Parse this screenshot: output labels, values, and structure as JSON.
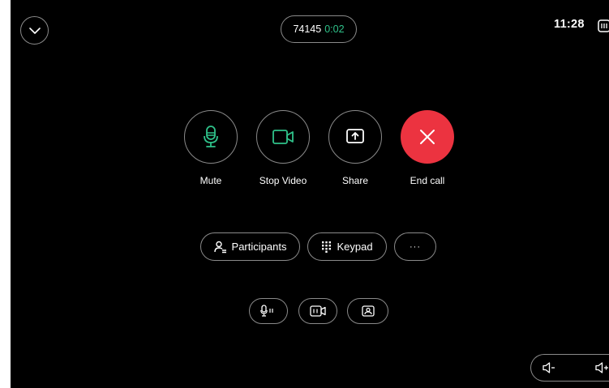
{
  "call": {
    "number": "74145",
    "duration": "0:02",
    "clock": "11:28"
  },
  "controls": {
    "mute_label": "Mute",
    "stop_video_label": "Stop Video",
    "share_label": "Share",
    "end_call_label": "End call"
  },
  "actions": {
    "participants_label": "Participants",
    "keypad_label": "Keypad",
    "more_label": "···"
  },
  "colors": {
    "accent_green": "#2fc28a",
    "end_call_red": "#ec3340",
    "outline": "#8a8a8a",
    "background": "#000000"
  },
  "icons": {
    "collapse": "chevron-down-icon",
    "layout": "layout-icon",
    "mute": "microphone-icon",
    "video": "video-camera-icon",
    "share": "share-icon",
    "end_call": "close-icon",
    "participants": "participants-icon",
    "keypad": "keypad-icon",
    "mic_settings": "microphone-settings-icon",
    "camera_settings": "camera-settings-icon",
    "selfview": "selfview-icon",
    "volume_down": "volume-down-icon",
    "volume_up": "volume-up-icon"
  }
}
